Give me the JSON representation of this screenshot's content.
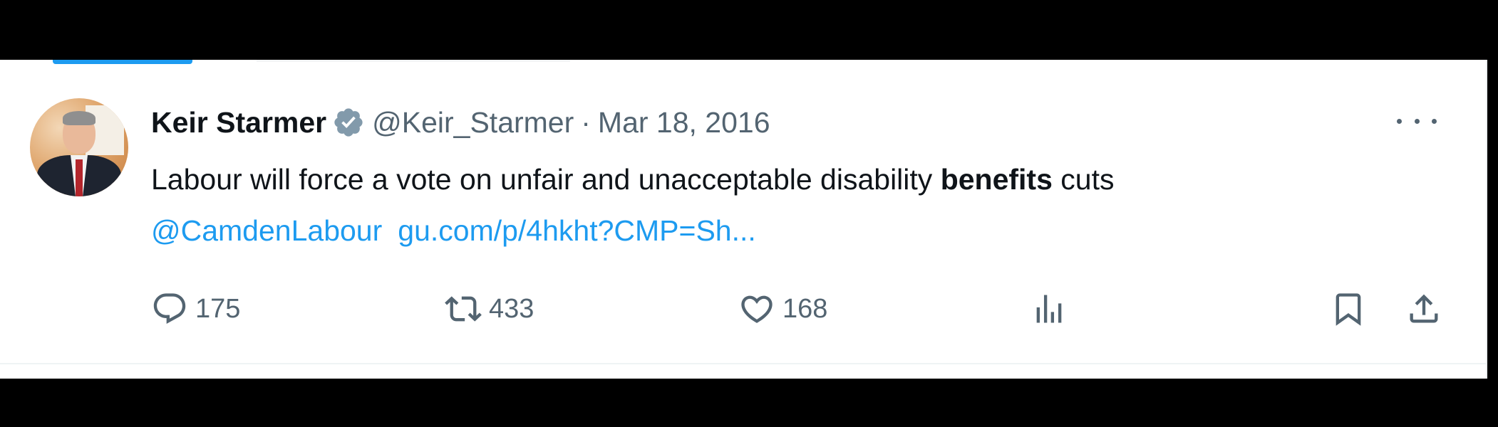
{
  "tweet": {
    "author_name": "Keir Starmer",
    "handle": "@Keir_Starmer",
    "separator": "·",
    "date": "Mar 18, 2016",
    "text_before": "Labour will force a vote on unfair and unacceptable disability ",
    "text_bold": "benefits",
    "text_after": " cuts",
    "mention": "@CamdenLabour",
    "link": "gu.com/p/4hkht?CMP=Sh..."
  },
  "actions": {
    "reply_count": "175",
    "retweet_count": "433",
    "like_count": "168"
  },
  "icons": {
    "verified": "verified-badge-icon",
    "more": "more-options-icon",
    "reply": "reply-icon",
    "retweet": "retweet-icon",
    "like": "heart-icon",
    "views": "analytics-icon",
    "bookmark": "bookmark-icon",
    "share": "share-icon"
  },
  "colors": {
    "accent": "#1d9bf0",
    "text_primary": "#0f1419",
    "text_secondary": "#536471",
    "verified_badge": "#829aab"
  }
}
